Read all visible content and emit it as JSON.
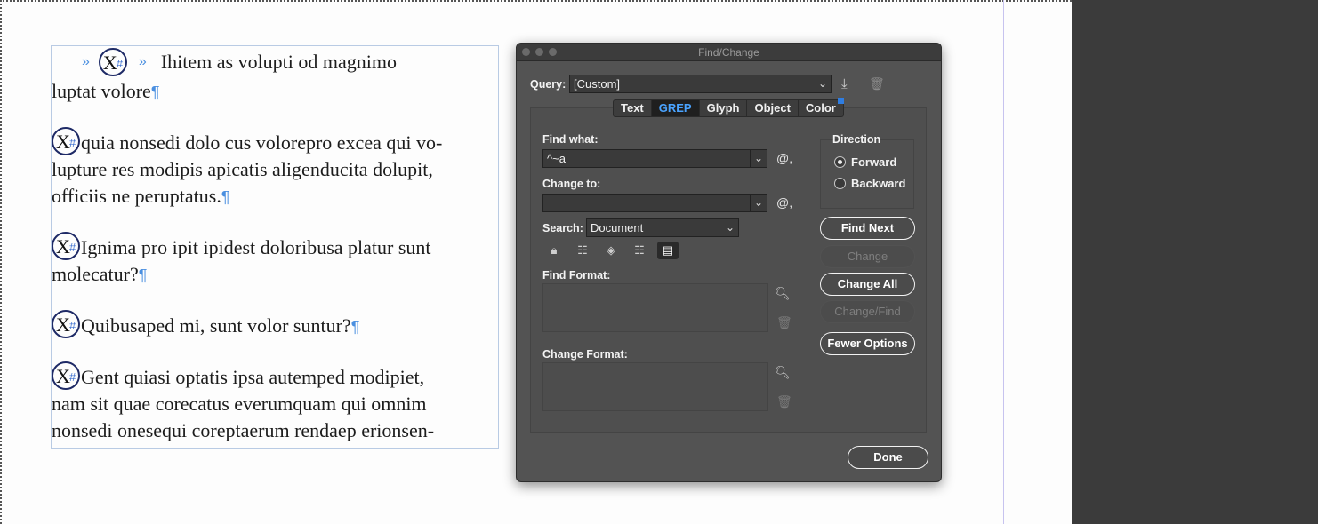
{
  "document": {
    "paragraphs": [
      {
        "text": "Ihitem as volupti od magnimo luptat volore",
        "line1": "Ihitem as volupti od magnimo",
        "line2": "luptat volore"
      },
      {
        "line1": "quia nonsedi dolo cus volorepro excea qui vo-",
        "line2": "lupture res modipis apicatis aligenducita dolupit,",
        "line3": "officiis ne peruptatus."
      },
      {
        "line1": "Ignima pro ipit ipidest doloribusa platur sunt",
        "line2": "molecatur?"
      },
      {
        "line1": "Quibusaped mi, sunt volor suntur?"
      },
      {
        "line1": "Gent quiasi optatis ipsa autemped modipiet,",
        "line2": "nam sit quae corecatus everumquam qui omnim",
        "line3": "nonsedi onesequi coreptaerum rendaep erionsen-"
      }
    ],
    "anchor_glyph": "X",
    "anchor_hash": "#",
    "pilcrow": "¶",
    "hidden_char": "»"
  },
  "dialog": {
    "title": "Find/Change",
    "query_label": "Query:",
    "query_value": "[Custom]",
    "tabs": [
      "Text",
      "GREP",
      "Glyph",
      "Object",
      "Color"
    ],
    "active_tab": "GREP",
    "find_what_label": "Find what:",
    "find_what_value": "^~a",
    "change_to_label": "Change to:",
    "change_to_value": "",
    "search_label": "Search:",
    "search_value": "Document",
    "find_format_label": "Find Format:",
    "change_format_label": "Change Format:",
    "direction_label": "Direction",
    "direction_options": [
      "Forward",
      "Backward"
    ],
    "direction_selected": "Forward",
    "buttons": {
      "find_next": "Find Next",
      "change": "Change",
      "change_all": "Change All",
      "change_find": "Change/Find",
      "fewer_options": "Fewer Options",
      "done": "Done"
    },
    "special_char_symbol": "@,",
    "search_option_icons": [
      "include-locked-layers-icon",
      "include-locked-stories-icon",
      "include-hidden-layers-icon",
      "include-master-pages-icon",
      "include-footnotes-icon"
    ],
    "accent_color": "#4aa3ff"
  }
}
